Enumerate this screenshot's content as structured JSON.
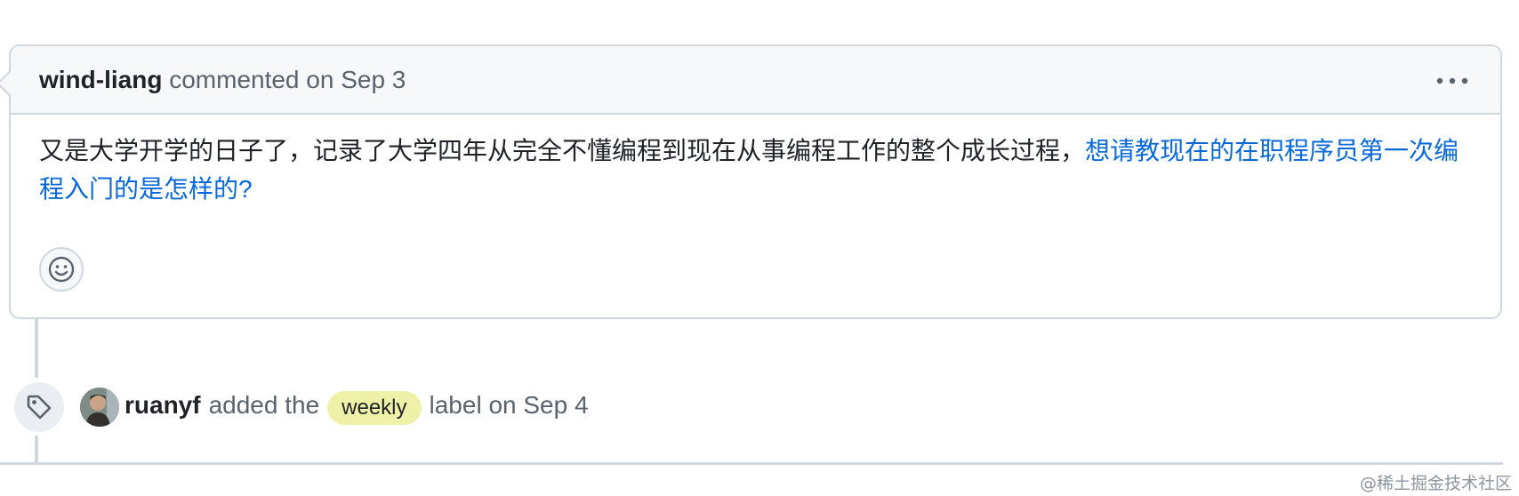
{
  "comment": {
    "author": "wind-liang",
    "action_text": "commented on Sep 3",
    "body_text": "又是大学开学的日子了，记录了大学四年从完全不懂编程到现在从事编程工作的整个成长过程，",
    "body_link_text": "想请教现在的在职程序员第一次编程入门的是怎样的?",
    "menu_icon": "kebab-horizontal-icon",
    "reaction_icon": "smiley-icon"
  },
  "event": {
    "icon": "tag-icon",
    "actor": "ruanyf",
    "text_before": "added the",
    "label": "weekly",
    "text_after": "label on Sep 4",
    "label_color": "#f0f1a8"
  },
  "watermark": "@稀土掘金技术社区",
  "colors": {
    "link": "#0969da",
    "border": "#d0d7de",
    "header_bg": "#f6f8fa",
    "muted_text": "#59636e"
  }
}
